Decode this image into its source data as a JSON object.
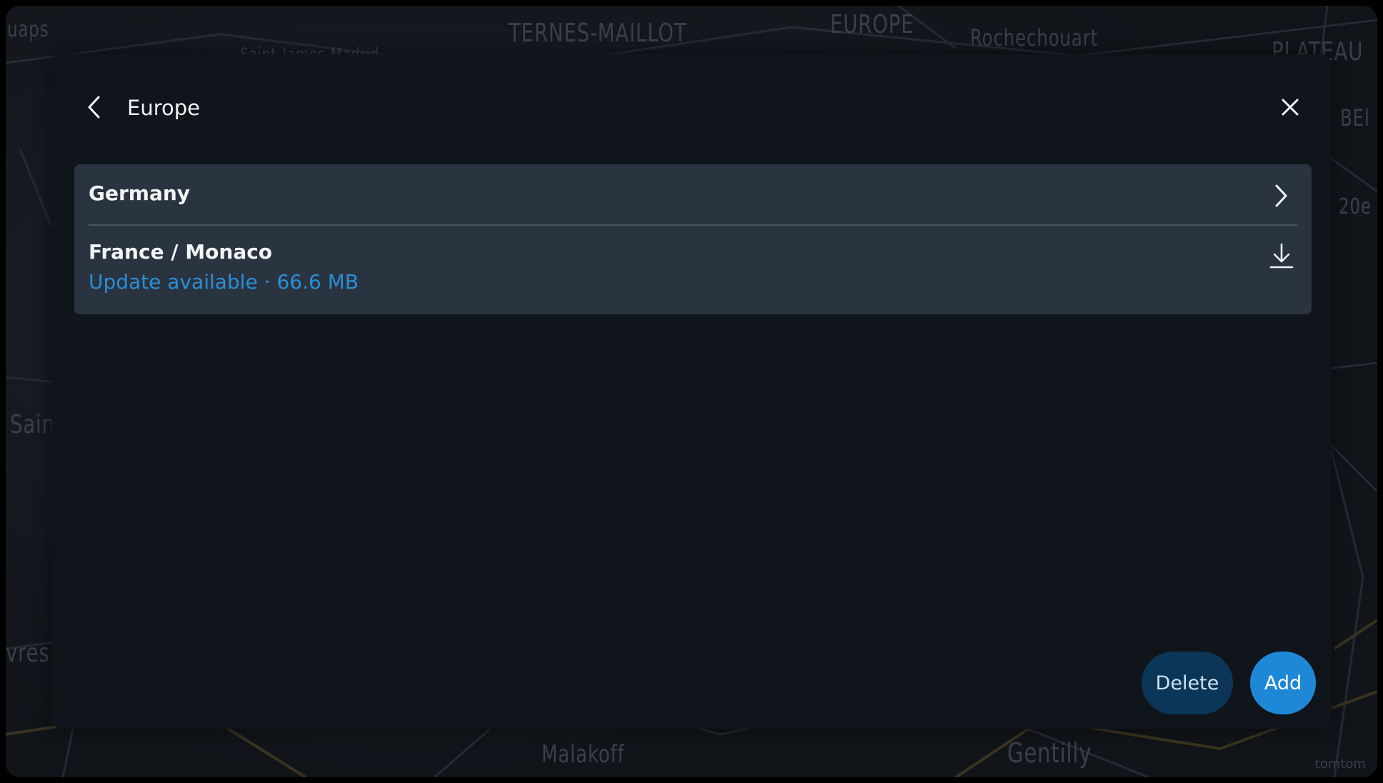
{
  "map": {
    "labels": [
      "uaps",
      "TERNES-MAILLOT",
      "EUROPE",
      "Rochechouart",
      "PLATEAU",
      "Saint-James-Madrid",
      "BEl",
      "20e",
      "Sain",
      "vres",
      "Malakoff",
      "Gentilly"
    ],
    "watermark": "tomtom"
  },
  "dialog": {
    "title": "Europe",
    "back_icon": "chevron-left-icon",
    "close_icon": "close-icon",
    "items": [
      {
        "name": "Germany",
        "icon": "chevron-right-icon"
      },
      {
        "name": "France / Monaco",
        "status": "Update available · 66.6 MB",
        "icon": "download-icon"
      }
    ],
    "buttons": {
      "delete": "Delete",
      "add": "Add"
    }
  },
  "colors": {
    "accent": "#1f88d6",
    "status_text": "#2c8ed6",
    "dialog_bg": "#10151c",
    "list_bg": "#293440",
    "delete_bg": "#0c3657"
  }
}
